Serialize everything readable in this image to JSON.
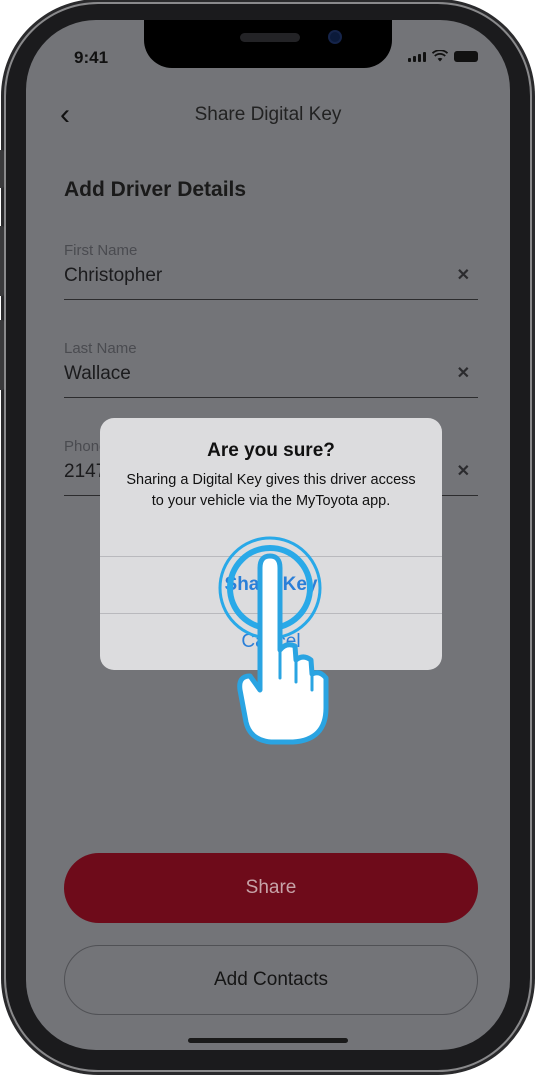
{
  "status_bar": {
    "time": "9:41"
  },
  "nav": {
    "back_icon": "chevron-left-icon",
    "back_glyph": "‹",
    "title": "Share Digital Key"
  },
  "form": {
    "section_title": "Add Driver Details",
    "fields": [
      {
        "label": "First Name",
        "value": "Christopher",
        "clear_glyph": "✕"
      },
      {
        "label": "Last Name",
        "value": "Wallace",
        "clear_glyph": "✕"
      },
      {
        "label": "Phone",
        "value": "2147",
        "clear_glyph": "✕"
      }
    ]
  },
  "alert": {
    "title": "Are you sure?",
    "message": "Sharing a Digital Key gives this driver access to your vehicle via the MyToyota app.",
    "confirm_label": "Share Key",
    "cancel_label": "Cancel"
  },
  "actions": {
    "share_label": "Share",
    "add_contacts_label": "Add Contacts"
  },
  "colors": {
    "share_button": "#6e0b1a",
    "alert_button_text": "#2a7fd8",
    "tap_highlight": "#29a9e8",
    "dim_background": "#737478"
  },
  "gesture": {
    "type": "tap",
    "icon": "hand-pointer-icon",
    "target": "Share Key"
  }
}
